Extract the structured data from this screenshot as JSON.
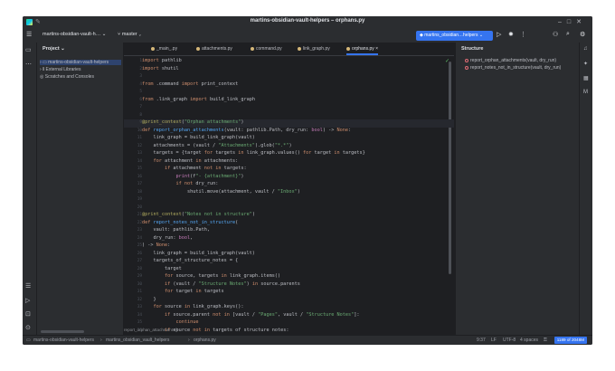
{
  "window": {
    "title": "martins-obsidian-vault-helpers – orphans.py"
  },
  "toolbar": {
    "project": "martins-obsidian-vault-h…",
    "branch": "master",
    "run_config": "martins_obsidian…helpers"
  },
  "project_panel": {
    "title": "Project",
    "items": [
      {
        "label": "martins-obsidian-vault-helpers"
      },
      {
        "label": "External Libraries"
      },
      {
        "label": "Scratches and Consoles"
      }
    ]
  },
  "tabs": [
    {
      "label": "_main_.py"
    },
    {
      "label": "attachments.py"
    },
    {
      "label": "command.py"
    },
    {
      "label": "link_graph.py"
    },
    {
      "label": "orphans.py"
    }
  ],
  "editor": {
    "lines": [
      {
        "n": "1",
        "code": "import pathlib"
      },
      {
        "n": "2",
        "code": "import shutil"
      },
      {
        "n": "3",
        "code": ""
      },
      {
        "n": "4",
        "code": "from .command import print_context"
      },
      {
        "n": "5",
        "code": ""
      },
      {
        "n": "6",
        "code": "from .link_graph import build_link_graph"
      },
      {
        "n": "7",
        "code": ""
      },
      {
        "n": "8",
        "code": ""
      },
      {
        "n": "9",
        "code": "@print_context(\"Orphan attachments\")"
      },
      {
        "n": "10",
        "code": "def report_orphan_attachments(vault: pathlib.Path, dry_run: bool) -> None:"
      },
      {
        "n": "11",
        "code": "    link_graph = build_link_graph(vault)"
      },
      {
        "n": "12",
        "code": "    attachments = (vault / \"Attachments\").glob(\"*.*\")"
      },
      {
        "n": "13",
        "code": "    targets = {target for targets in link_graph.values() for target in targets}"
      },
      {
        "n": "14",
        "code": "    for attachment in attachments:"
      },
      {
        "n": "15",
        "code": "        if attachment not in targets:"
      },
      {
        "n": "16",
        "code": "            print(f\"- {attachment}\")"
      },
      {
        "n": "17",
        "code": "            if not dry_run:"
      },
      {
        "n": "18",
        "code": "                shutil.move(attachment, vault / \"Inbox\")"
      },
      {
        "n": "19",
        "code": ""
      },
      {
        "n": "20",
        "code": ""
      },
      {
        "n": "21",
        "code": "@print_context(\"Notes not in structure\")"
      },
      {
        "n": "22",
        "code": "def report_notes_not_in_structure("
      },
      {
        "n": "23",
        "code": "    vault: pathlib.Path,"
      },
      {
        "n": "24",
        "code": "    dry_run: bool,"
      },
      {
        "n": "25",
        "code": ") -> None:"
      },
      {
        "n": "26",
        "code": "    link_graph = build_link_graph(vault)"
      },
      {
        "n": "27",
        "code": "    targets_of_structure_notes = {"
      },
      {
        "n": "28",
        "code": "        target"
      },
      {
        "n": "29",
        "code": "        for source, targets in link_graph.items()"
      },
      {
        "n": "30",
        "code": "        if (vault / \"Structure Notes\") in source.parents"
      },
      {
        "n": "31",
        "code": "        for target in targets"
      },
      {
        "n": "32",
        "code": "    }"
      },
      {
        "n": "33",
        "code": "    for source in link_graph.keys():"
      },
      {
        "n": "34",
        "code": "        if source.parent not in [vault / \"Pages\", vault / \"Structure Notes\"]:"
      },
      {
        "n": "35",
        "code": "            continue"
      },
      {
        "n": "36",
        "code": "        if source not in targets of structure notes:"
      }
    ],
    "breadcrumb_tip": "report_orphan_attachments()"
  },
  "structure_panel": {
    "title": "Structure",
    "items": [
      {
        "label": "report_orphan_attachments(vault, dry_run)"
      },
      {
        "label": "report_notes_not_in_structure(vault, dry_run)"
      }
    ]
  },
  "status_bar": {
    "path": [
      "martins-obsidian-vault-helpers",
      "martins_obsidian_vault_helpers",
      "orphans.py"
    ],
    "position": "9:37",
    "line_sep": "LF",
    "encoding": "UTF-8",
    "indent": "4 spaces",
    "memory": "1189 of 2048M"
  }
}
